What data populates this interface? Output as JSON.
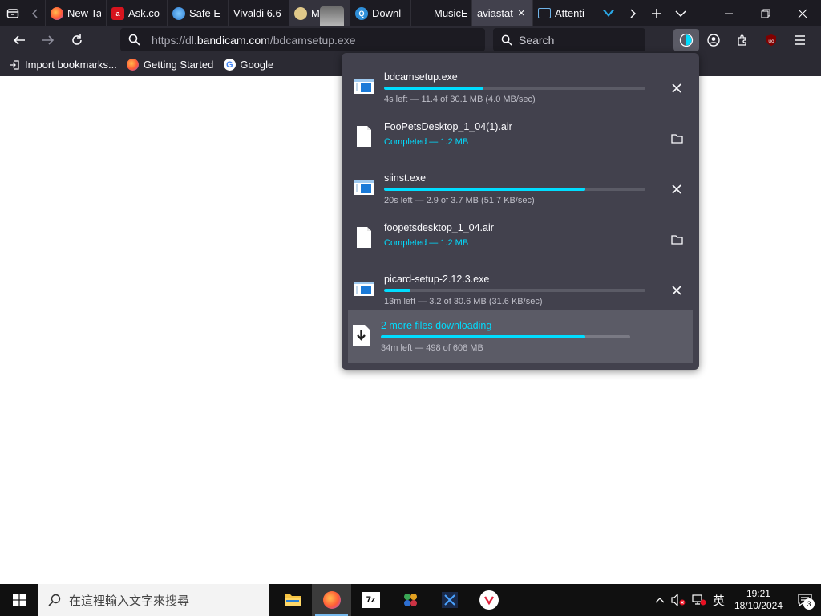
{
  "window": {
    "tabs": [
      {
        "label": "New Ta",
        "favicon": "firefox-icon",
        "active": false
      },
      {
        "label": "Ask.co",
        "favicon": "ask-icon",
        "active": false
      },
      {
        "label": "Safe E",
        "favicon": "globe-icon",
        "active": false
      },
      {
        "label": "Vivaldi 6.6",
        "favicon": "",
        "active": false
      },
      {
        "label": "M",
        "favicon": "musicbrainz-icon",
        "active": false
      },
      {
        "label": "Downl",
        "favicon": "q-icon",
        "active": false
      },
      {
        "label": "MusicE",
        "favicon": "",
        "active": false
      },
      {
        "label": "aviastat",
        "favicon": "",
        "active": true
      },
      {
        "label": "Attenti",
        "favicon": "monitor-icon",
        "active": false
      }
    ]
  },
  "navbar": {
    "url_prefix": "https://dl.",
    "url_domain": "bandicam.com",
    "url_path": "/bdcamsetup.exe",
    "search_placeholder": "Search"
  },
  "bookmarks": [
    {
      "label": "Import bookmarks...",
      "icon": "import-icon"
    },
    {
      "label": "Getting Started",
      "icon": "firefox-icon"
    },
    {
      "label": "Google",
      "icon": "google-icon"
    }
  ],
  "downloads": {
    "items": [
      {
        "name": "bdcamsetup.exe",
        "status": "4s left — 11.4 of 30.1 MB (4.0 MB/sec)",
        "progress": 0.38,
        "state": "downloading",
        "icon": "exe-file-icon"
      },
      {
        "name": "FooPetsDesktop_1_04(1).air",
        "status": "Completed — 1.2 MB",
        "progress": 1,
        "state": "completed",
        "icon": "blank-file-icon"
      },
      {
        "name": "siinst.exe",
        "status": "20s left — 2.9 of 3.7 MB (51.7 KB/sec)",
        "progress": 0.77,
        "state": "downloading",
        "icon": "exe-file-icon"
      },
      {
        "name": "foopetsdesktop_1_04.air",
        "status": "Completed — 1.2 MB",
        "progress": 1,
        "state": "completed",
        "icon": "blank-file-icon"
      },
      {
        "name": "picard-setup-2.12.3.exe",
        "status": "13m left — 3.2 of 30.6 MB (31.6 KB/sec)",
        "progress": 0.1,
        "state": "downloading",
        "icon": "exe-file-icon"
      }
    ],
    "summary": {
      "title": "2 more files downloading",
      "status": "34m left — 498 of 608 MB",
      "progress": 0.82
    }
  },
  "taskbar": {
    "search_placeholder": "在這裡輸入文字來搜尋",
    "apps": [
      "file-explorer-icon",
      "firefox-icon",
      "7zip-icon",
      "app-icon",
      "app-icon",
      "bandicam-icon"
    ],
    "ime": "英",
    "time": "19:21",
    "date": "18/10/2024",
    "notifications": "3"
  },
  "colors": {
    "accent": "#00ddff",
    "panel_bg": "#42414d",
    "toolbar_bg": "#2b2a33",
    "tabstrip_bg": "#1c1b22"
  }
}
